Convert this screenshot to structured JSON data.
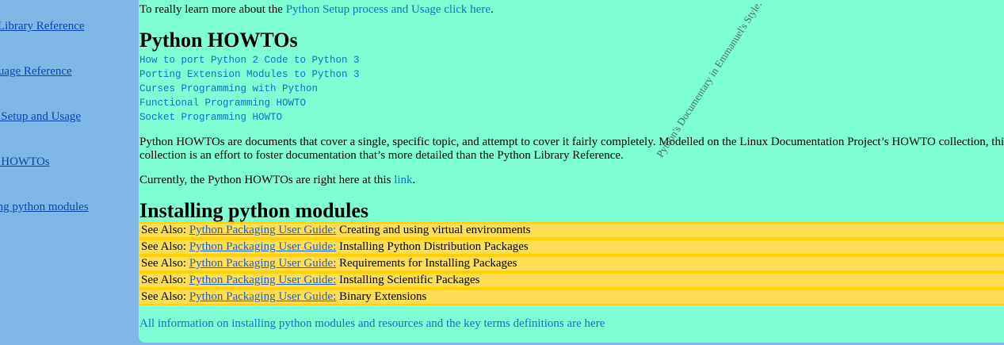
{
  "sidebar": {
    "items": [
      {
        "label": "Library Reference"
      },
      {
        "label": "Language Reference"
      },
      {
        "label": "Python Setup and Usage"
      },
      {
        "label": "Python HOWTOs"
      },
      {
        "label": "Installing python modules"
      }
    ]
  },
  "intro": {
    "prefix": "To really learn more about the ",
    "link": "Python Setup process and Usage click here",
    "suffix": "."
  },
  "howtos": {
    "heading": "Python HOWTOs",
    "links": [
      "How to port Python 2 Code to Python 3",
      "Porting Extension Modules to Python 3",
      "Curses Programming with Python",
      "Functional Programming HOWTO",
      "Socket Programming HOWTO"
    ],
    "description": "Python HOWTOs are documents that cover a single, specific topic, and attempt to cover it fairly completely. Modelled on the Linux Documentation Project’s HOWTO collection, this collection is an effort to foster documentation that’s more detailed than the Python Library Reference.",
    "currently_prefix": "Currently, the Python HOWTOs are right here at this ",
    "currently_link": "link",
    "currently_suffix": "."
  },
  "installing": {
    "heading": "Installing python modules",
    "see_also_prefix": "See Also: ",
    "guide_link": "Python Packaging User Guide:",
    "items": [
      "Creating and using virtual environments",
      "Installing Python Distribution Packages",
      "Requirements for Installing Packages",
      "Installing Scientific Packages",
      "Binary Extensions"
    ],
    "footer_link": "All information on installing python modules and resources and the key terms definitions are here"
  },
  "watermark": "Python's Documentary in Emmanuel's Style.",
  "colors": {
    "sidebar_bg": "#7fb8e6",
    "main_bg": "#7fffd4",
    "see_also_bg": "#ffdd55",
    "see_also_border": "#ffd200",
    "link": "#0b72c4"
  }
}
